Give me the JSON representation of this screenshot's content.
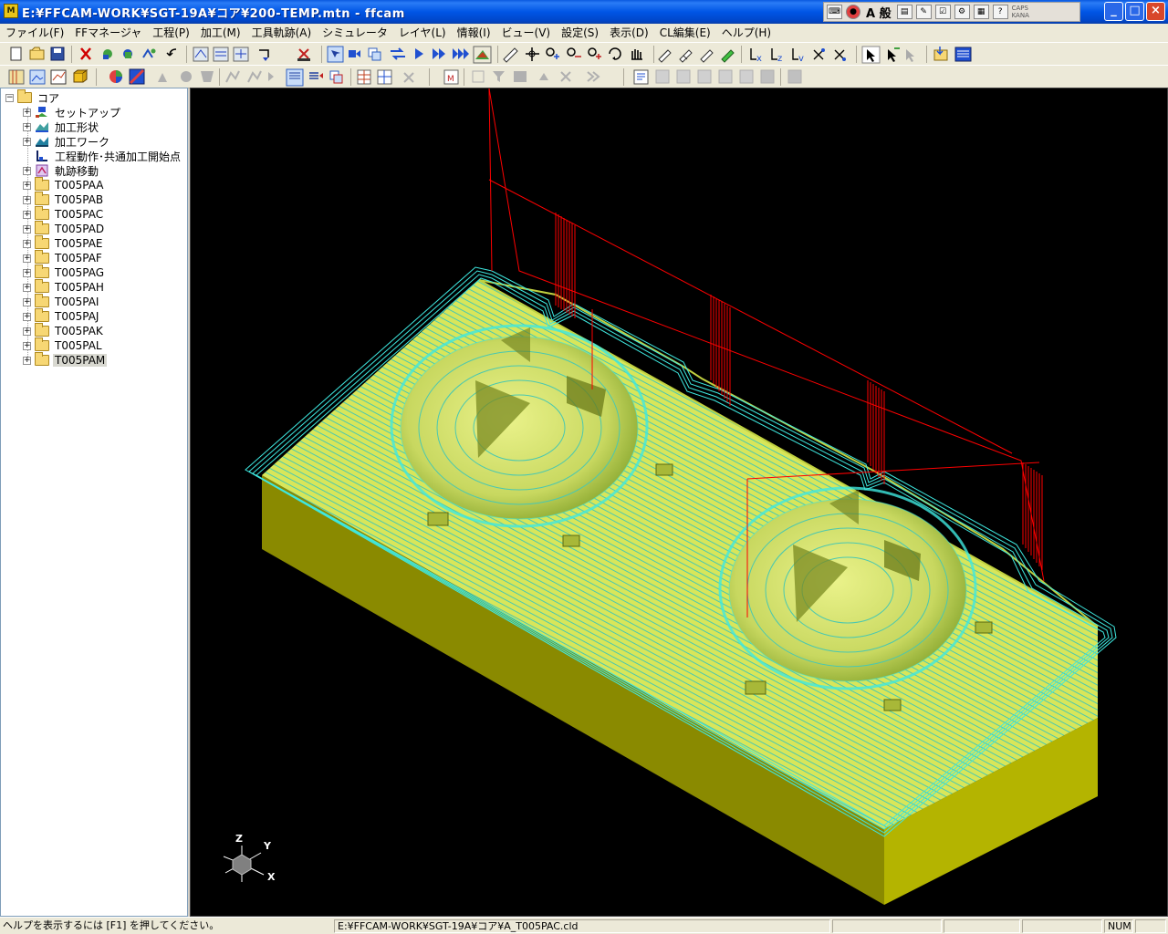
{
  "window": {
    "title": "E:¥FFCAM-WORK¥SGT-19A¥コア¥200-TEMP.mtn - ffcam",
    "app_icon_text": "M",
    "controls": {
      "minimize": "_",
      "maximize": "□",
      "close": "×"
    }
  },
  "ime": {
    "mode_label": "A 般",
    "caps_label": "CAPS",
    "kana_label": "KANA",
    "icons": [
      "keyboard-icon",
      "ime-pad-icon",
      "dictionary-icon",
      "tools-icon",
      "properties-icon",
      "help-icon"
    ]
  },
  "menu": {
    "items": [
      "ファイル(F)",
      "FFマネージャ",
      "工程(P)",
      "加工(M)",
      "工具軌跡(A)",
      "シミュレータ",
      "レイヤ(L)",
      "情報(I)",
      "ビュー(V)",
      "設定(S)",
      "表示(D)",
      "CL編集(E)",
      "ヘルプ(H)"
    ]
  },
  "tree": {
    "root": "コア",
    "items": [
      {
        "label": "セットアップ",
        "icon": "setup-icon"
      },
      {
        "label": "加工形状",
        "icon": "machining-shape-icon"
      },
      {
        "label": "加工ワーク",
        "icon": "workpiece-icon"
      },
      {
        "label": "工程動作･共通加工開始点",
        "icon": "process-start-icon"
      },
      {
        "label": "軌跡移動",
        "icon": "path-move-icon"
      },
      {
        "label": "T005PAA",
        "icon": "folder-icon"
      },
      {
        "label": "T005PAB",
        "icon": "folder-icon"
      },
      {
        "label": "T005PAC",
        "icon": "folder-icon"
      },
      {
        "label": "T005PAD",
        "icon": "folder-icon"
      },
      {
        "label": "T005PAE",
        "icon": "folder-icon"
      },
      {
        "label": "T005PAF",
        "icon": "folder-icon"
      },
      {
        "label": "T005PAG",
        "icon": "folder-icon"
      },
      {
        "label": "T005PAH",
        "icon": "folder-icon"
      },
      {
        "label": "T005PAI",
        "icon": "folder-icon"
      },
      {
        "label": "T005PAJ",
        "icon": "folder-icon"
      },
      {
        "label": "T005PAK",
        "icon": "folder-icon"
      },
      {
        "label": "T005PAL",
        "icon": "folder-icon"
      },
      {
        "label": "T005PAM",
        "icon": "folder-icon",
        "selected": true
      }
    ]
  },
  "viewport": {
    "axis": {
      "z": "Z",
      "y": "Y",
      "x": "X"
    },
    "colors": {
      "background": "#000000",
      "part_top": "#d8e65a",
      "part_side": "#808000",
      "toolpath_cyan": "#3ee8e0",
      "rapid_red": "#ff0000"
    }
  },
  "status": {
    "help_text": "ヘルプを表示するには [F1] を押してください。",
    "file_path": "E:¥FFCAM-WORK¥SGT-19A¥コア¥A_T005PAC.cld",
    "num": "NUM"
  }
}
